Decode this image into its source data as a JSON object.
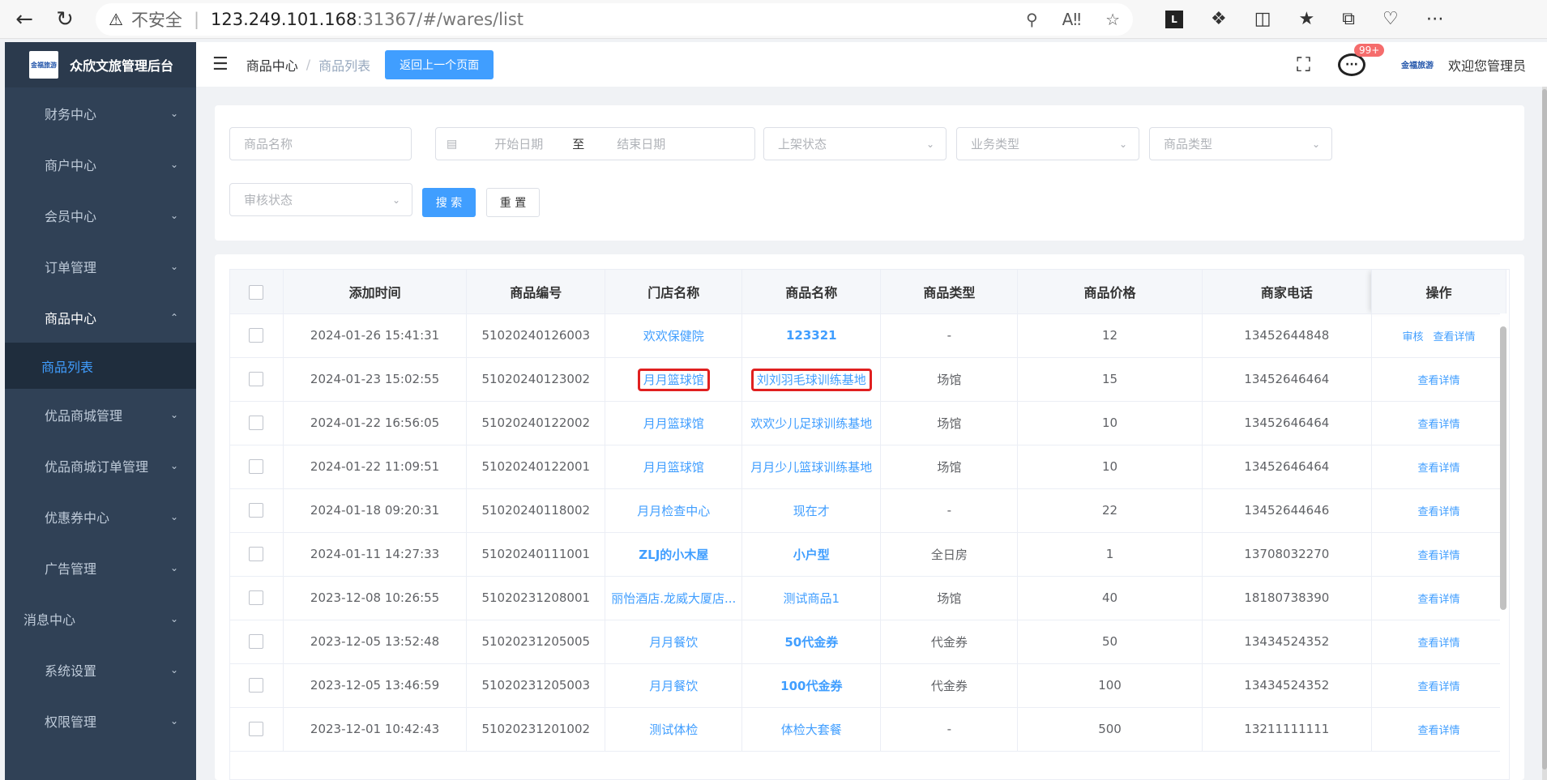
{
  "browser": {
    "security": "不安全",
    "url_host": "123.249.101.168",
    "url_path": ":31367/#/wares/list"
  },
  "sidebar": {
    "title": "众欣文旅管理后台",
    "logo_text": "金福旅游",
    "items": [
      {
        "label": "财务中心"
      },
      {
        "label": "商户中心"
      },
      {
        "label": "会员中心"
      },
      {
        "label": "订单管理"
      },
      {
        "label": "商品中心"
      },
      {
        "label": "商品列表"
      },
      {
        "label": "优品商城管理"
      },
      {
        "label": "优品商城订单管理"
      },
      {
        "label": "优惠券中心"
      },
      {
        "label": "广告管理"
      },
      {
        "label": "消息中心"
      },
      {
        "label": "系统设置"
      },
      {
        "label": "权限管理"
      }
    ]
  },
  "header": {
    "breadcrumb_root": "商品中心",
    "breadcrumb_sep": "/",
    "breadcrumb_current": "商品列表",
    "back_button": "返回上一个页面",
    "badge": "99+",
    "avatar_text": "金福旅游",
    "welcome": "欢迎您管理员"
  },
  "filters": {
    "name_placeholder": "商品名称",
    "start_date_placeholder": "开始日期",
    "date_to": "至",
    "end_date_placeholder": "结束日期",
    "shelf_status_placeholder": "上架状态",
    "business_type_placeholder": "业务类型",
    "goods_type_placeholder": "商品类型",
    "audit_status_placeholder": "审核状态",
    "search_button": "搜 索",
    "reset_button": "重 置"
  },
  "table": {
    "columns": [
      "添加时间",
      "商品编号",
      "门店名称",
      "商品名称",
      "商品类型",
      "商品价格",
      "商家电话",
      "操作"
    ],
    "rows": [
      {
        "time": "2024-01-26 15:41:31",
        "code": "51020240126003",
        "store": "欢欢保健院",
        "name": "123321",
        "type": "-",
        "price": "12",
        "phone": "13452644848",
        "ops": [
          "审核",
          "查看详情"
        ]
      },
      {
        "time": "2024-01-23 15:02:55",
        "code": "51020240123002",
        "store": "月月篮球馆",
        "name": "刘刘羽毛球训练基地",
        "type": "场馆",
        "price": "15",
        "phone": "13452646464",
        "ops": [
          "查看详情"
        ]
      },
      {
        "time": "2024-01-22 16:56:05",
        "code": "51020240122002",
        "store": "月月篮球馆",
        "name": "欢欢少儿足球训练基地",
        "type": "场馆",
        "price": "10",
        "phone": "13452646464",
        "ops": [
          "查看详情"
        ]
      },
      {
        "time": "2024-01-22 11:09:51",
        "code": "51020240122001",
        "store": "月月篮球馆",
        "name": "月月少儿篮球训练基地",
        "type": "场馆",
        "price": "10",
        "phone": "13452646464",
        "ops": [
          "查看详情"
        ]
      },
      {
        "time": "2024-01-18 09:20:31",
        "code": "51020240118002",
        "store": "月月检查中心",
        "name": "现在才",
        "type": "-",
        "price": "22",
        "phone": "13452644646",
        "ops": [
          "查看详情"
        ]
      },
      {
        "time": "2024-01-11 14:27:33",
        "code": "51020240111001",
        "store": "ZLJ的小木屋",
        "name": "小户型",
        "type": "全日房",
        "price": "1",
        "phone": "13708032270",
        "ops": [
          "查看详情"
        ]
      },
      {
        "time": "2023-12-08 10:26:55",
        "code": "51020231208001",
        "store": "丽怡酒店.龙威大厦店...",
        "name": "测试商品1",
        "type": "场馆",
        "price": "40",
        "phone": "18180738390",
        "ops": [
          "查看详情"
        ]
      },
      {
        "time": "2023-12-05 13:52:48",
        "code": "51020231205005",
        "store": "月月餐饮",
        "name": "50代金券",
        "type": "代金券",
        "price": "50",
        "phone": "13434524352",
        "ops": [
          "查看详情"
        ]
      },
      {
        "time": "2023-12-05 13:46:59",
        "code": "51020231205003",
        "store": "月月餐饮",
        "name": "100代金券",
        "type": "代金券",
        "price": "100",
        "phone": "13434524352",
        "ops": [
          "查看详情"
        ]
      },
      {
        "time": "2023-12-01 10:42:43",
        "code": "51020231201002",
        "store": "测试体检",
        "name": "体检大套餐",
        "type": "-",
        "price": "500",
        "phone": "13211111111",
        "ops": [
          "查看详情"
        ]
      }
    ]
  }
}
